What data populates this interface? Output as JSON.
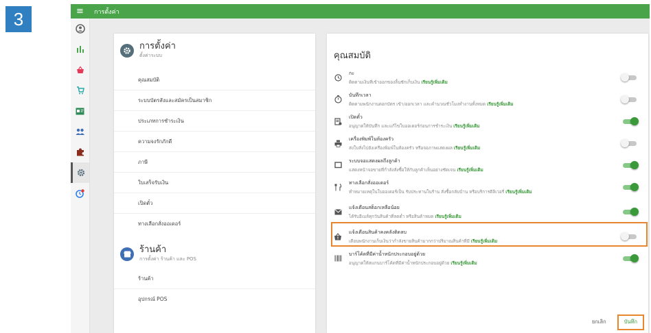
{
  "step_number": "3",
  "app": {
    "title": "การตั้งค่า",
    "menu_icon": "hamburger-icon"
  },
  "rail": {
    "items": [
      {
        "icon": "user-icon"
      },
      {
        "icon": "bar-chart-icon"
      },
      {
        "icon": "basket-icon"
      },
      {
        "icon": "cart-icon"
      },
      {
        "icon": "id-card-icon"
      },
      {
        "icon": "people-icon"
      },
      {
        "icon": "puzzle-icon"
      },
      {
        "icon": "gear-icon",
        "active": true
      },
      {
        "icon": "clock-badge-icon"
      }
    ]
  },
  "settings_section": {
    "title": "การตั้งค่า",
    "subtitle": "ตั้งค่าระบบ",
    "items": [
      "คุณสมบัติ",
      "ระบบบัตรสังและสมัครเป็นสมาชิก",
      "ประเภทการชำระเงิน",
      "ความจงรักภักดี",
      "ภาษี",
      "ใบเสร็จรับเงิน",
      "เปิดตั๋ว",
      "ทางเลือกสั่งออเดอร์"
    ]
  },
  "store_section": {
    "title": "ร้านค้า",
    "subtitle": "การตั้งค่า ร้านค้า และ POS",
    "items": [
      "ร้านค้า",
      "อุปกรณ์ POS"
    ]
  },
  "features": {
    "title": "คุณสมบัติ",
    "learn_more": "เรียนรู้เพิ่มเติม",
    "rows": [
      {
        "name": "กะ",
        "desc": "ติดตามเงินที่เข้าออกของลิ้นชักเก็บเงิน",
        "on": false,
        "icon": "clock-icon"
      },
      {
        "name": "บันทึกเวลา",
        "desc": "ติดตามพนักงานตอกบัตร เข้า/ออกเวลา และคำนวณชั่วโมงทำงานทั้งหมด",
        "on": false,
        "icon": "timer-icon"
      },
      {
        "name": "เปิดตั๋ว",
        "desc": "อนุญาตให้บันทึก และแก้ไขใบออเดอร์ก่อนการชำระเงิน",
        "on": true,
        "icon": "ticket-icon"
      },
      {
        "name": "เครื่องพิมพ์ในห้องครัว",
        "desc": "ส่งใบสั่งไปยังเครื่องพิมพ์ในห้องครัว หรือจอภาพแสดงผล",
        "on": false,
        "icon": "printer-icon"
      },
      {
        "name": "ระบบจอแสดงผลถึงลูกค้า",
        "desc": "แสดงหน้าจอขายที่กำลังสั่งซื้อให้กับลูกค้าเห็นอย่างชัดเจน",
        "on": true,
        "icon": "monitor-icon"
      },
      {
        "name": "ทางเลือกสั่งออเดอร์",
        "desc": "ทำหมายเหตุในใบออเดอร์เป็น รับประทานในร้าน สั่งซื้อกลับบ้าน หรือบริการดีลิเวอรี่",
        "on": true,
        "icon": "cutlery-icon"
      },
      {
        "name": "แจ้งเตือนสต็อกเหลือน้อย",
        "desc": "ได้รับอีเมล์ทุกวันสินค้าที่ลดต่ำ หรือสินค้าหมด",
        "on": true,
        "icon": "mail-icon"
      },
      {
        "name": "แจ้งเตือนสินค้าคงคลังติดลบ",
        "desc": "เตือนพนักงานเก็บเงินว่ากำลังขายสินค้ามากกว่าปริมาณสินค้าที่มี",
        "on": false,
        "icon": "alert-bag-icon"
      },
      {
        "name": "บาร์โค้ดที่มีค่าน้ำหนักประกอบอยู่ด้วย",
        "desc": "อนุญาตให้สแกนบาร์โค้ดที่มีค่าน้ำหนักประกอบอยู่ด้วย",
        "on": true,
        "icon": "barcode-icon"
      }
    ],
    "cancel_label": "ยกเลิก",
    "save_label": "บันทึก"
  }
}
